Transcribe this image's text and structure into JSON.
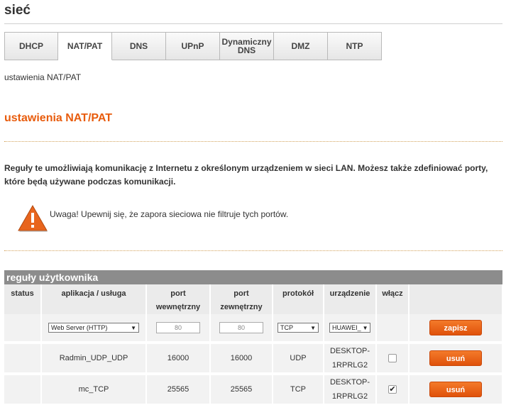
{
  "page": {
    "title": "sieć",
    "breadcrumb": "ustawienia NAT/PAT"
  },
  "tabs": [
    {
      "label": "DHCP"
    },
    {
      "label": "NAT/PAT",
      "active": true
    },
    {
      "label": "DNS"
    },
    {
      "label": "UPnP"
    },
    {
      "label_line1": "Dynamiczny",
      "label_line2": "DNS"
    },
    {
      "label": "DMZ"
    },
    {
      "label": "NTP"
    }
  ],
  "section": {
    "title": "ustawienia NAT/PAT",
    "description": "Reguły te umożliwiają komunikację z Internetu z określonym urządzeniem w sieci LAN. Możesz także zdefiniować porty, które będą używane podczas komunikacji.",
    "warning": "Uwaga! Upewnij się, że zapora sieciowa nie filtruje tych portów."
  },
  "rules": {
    "title": "reguły użytkownika",
    "columns": {
      "status": "status",
      "app": "aplikacja / usługa",
      "port_internal_1": "port",
      "port_internal_2": "wewnętrzny",
      "port_external_1": "port",
      "port_external_2": "zewnętrzny",
      "protocol": "protokół",
      "device": "urządzenie",
      "enable": "włącz"
    },
    "new_rule": {
      "app_select": "Web Server (HTTP)",
      "port_internal": "80",
      "port_external": "80",
      "protocol_select": "TCP",
      "device_select": "HUAWEI_",
      "save_label": "zapisz"
    },
    "rows": [
      {
        "app": "Radmin_UDP_UDP",
        "port_internal": "16000",
        "port_external": "16000",
        "protocol": "UDP",
        "device_line1": "DESKTOP-",
        "device_line2": "1RPRLG2",
        "enabled": false,
        "remove_label": "usuń"
      },
      {
        "app": "mc_TCP",
        "port_internal": "25565",
        "port_external": "25565",
        "protocol": "TCP",
        "device_line1": "DESKTOP-",
        "device_line2": "1RPRLG2",
        "enabled": true,
        "remove_label": "usuń"
      }
    ]
  },
  "colors": {
    "accent": "#e85c0d",
    "header_gray": "#8c8c8c"
  }
}
